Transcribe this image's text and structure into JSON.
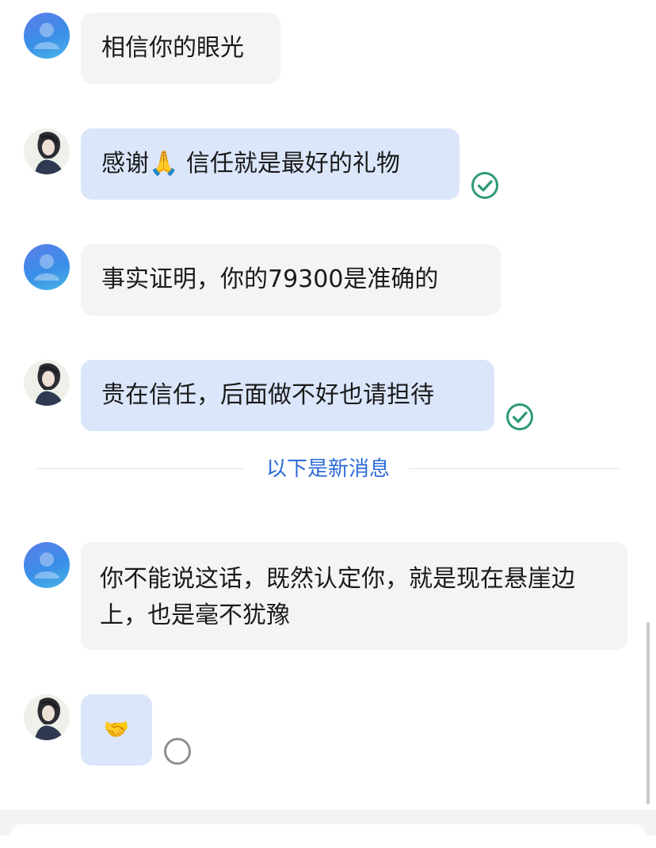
{
  "messages": [
    {
      "sender": "contact",
      "text": "相信你的眼光"
    },
    {
      "sender": "me",
      "text": "感谢🙏 信任就是最好的礼物",
      "status": "read"
    },
    {
      "sender": "contact",
      "text": "事实证明，你的79300是准确的"
    },
    {
      "sender": "me",
      "text": "贵在信任，后面做不好也请担待",
      "status": "read"
    },
    {
      "sender": "contact",
      "text": "你不能说这话，既然认定你，就是现在悬崖边上，也是毫不犹豫"
    },
    {
      "sender": "me",
      "text": "🤝",
      "status": "sending"
    }
  ],
  "divider": {
    "label": "以下是新消息"
  },
  "colors": {
    "accent": "#2d6bd8",
    "read_check": "#2e9a72",
    "incoming_bubble": "#f3f4f6",
    "outgoing_bubble": "#dbe6fb"
  },
  "icons": {
    "read": "check-circle-icon",
    "sending": "pending-circle-icon",
    "contact_avatar": "default-user-avatar",
    "my_avatar": "photo-avatar"
  }
}
